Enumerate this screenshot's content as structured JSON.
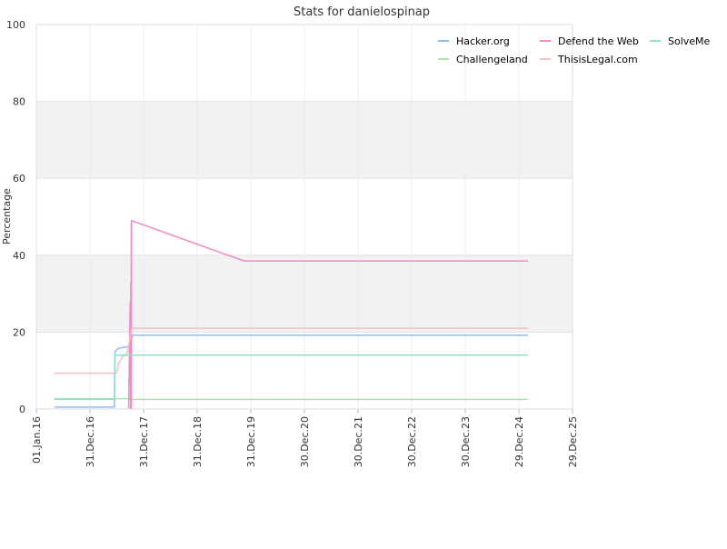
{
  "chart_data": {
    "type": "line",
    "title": "Stats for danielospinap",
    "xlabel": "",
    "ylabel": "Percentage",
    "ylim": [
      0,
      100
    ],
    "xlim": [
      "2016-01-01",
      "2025-12-29"
    ],
    "y_ticks": [
      "0",
      "20",
      "40",
      "60",
      "80",
      "100"
    ],
    "x_ticks": [
      {
        "date": "2016-01-01",
        "label": "01.Jan.16"
      },
      {
        "date": "2016-12-31",
        "label": "31.Dec.16"
      },
      {
        "date": "2017-12-31",
        "label": "31.Dec.17"
      },
      {
        "date": "2018-12-31",
        "label": "31.Dec.18"
      },
      {
        "date": "2019-12-31",
        "label": "31.Dec.19"
      },
      {
        "date": "2020-12-30",
        "label": "30.Dec.20"
      },
      {
        "date": "2021-12-30",
        "label": "30.Dec.21"
      },
      {
        "date": "2022-12-30",
        "label": "30.Dec.22"
      },
      {
        "date": "2023-12-30",
        "label": "30.Dec.23"
      },
      {
        "date": "2024-12-29",
        "label": "29.Dec.24"
      },
      {
        "date": "2025-12-29",
        "label": "29.Dec.25"
      }
    ],
    "grid": true,
    "alternating_bands": true,
    "legend_position": "top-right",
    "series": [
      {
        "name": "Hacker.org",
        "color": "#90bdf0",
        "points": [
          [
            "2016-05-01",
            0.5
          ],
          [
            "2017-06-15",
            0.5
          ],
          [
            "2017-06-20",
            15.0
          ],
          [
            "2017-07-15",
            15.8
          ],
          [
            "2017-09-10",
            16.2
          ],
          [
            "2017-10-05",
            16.3
          ],
          [
            "2017-10-12",
            19.2
          ],
          [
            "2025-03-01",
            19.2
          ]
        ]
      },
      {
        "name": "Challengeland",
        "color": "#a8e6a8",
        "points": [
          [
            "2016-05-01",
            2.7
          ],
          [
            "2017-10-10",
            2.7
          ],
          [
            "2017-10-12",
            2.5
          ],
          [
            "2025-03-01",
            2.5
          ]
        ]
      },
      {
        "name": "Defend the Web",
        "color": "#f08cc4",
        "points": [
          [
            "2017-09-20",
            0.0
          ],
          [
            "2017-10-01",
            28.0
          ],
          [
            "2017-10-03",
            0.0
          ],
          [
            "2017-10-05",
            33.0
          ],
          [
            "2017-10-07",
            0.0
          ],
          [
            "2017-10-08",
            48.5
          ],
          [
            "2017-10-09",
            0.0
          ],
          [
            "2017-10-10",
            49.0
          ],
          [
            "2019-11-15",
            38.5
          ],
          [
            "2025-03-01",
            38.5
          ]
        ]
      },
      {
        "name": "ThisisLegal.com",
        "color": "#f6c0bc",
        "points": [
          [
            "2016-05-01",
            9.3
          ],
          [
            "2017-06-20",
            9.3
          ],
          [
            "2017-07-01",
            9.5
          ],
          [
            "2017-07-15",
            12.0
          ],
          [
            "2017-08-10",
            13.5
          ],
          [
            "2017-09-10",
            14.5
          ],
          [
            "2017-10-12",
            21.0
          ],
          [
            "2025-03-01",
            21.0
          ]
        ]
      },
      {
        "name": "SolveMe",
        "color": "#8ee0cc",
        "points": [
          [
            "2016-05-01",
            2.5
          ],
          [
            "2017-06-15",
            2.5
          ],
          [
            "2017-06-18",
            14.0
          ],
          [
            "2025-03-01",
            14.0
          ]
        ]
      }
    ]
  }
}
